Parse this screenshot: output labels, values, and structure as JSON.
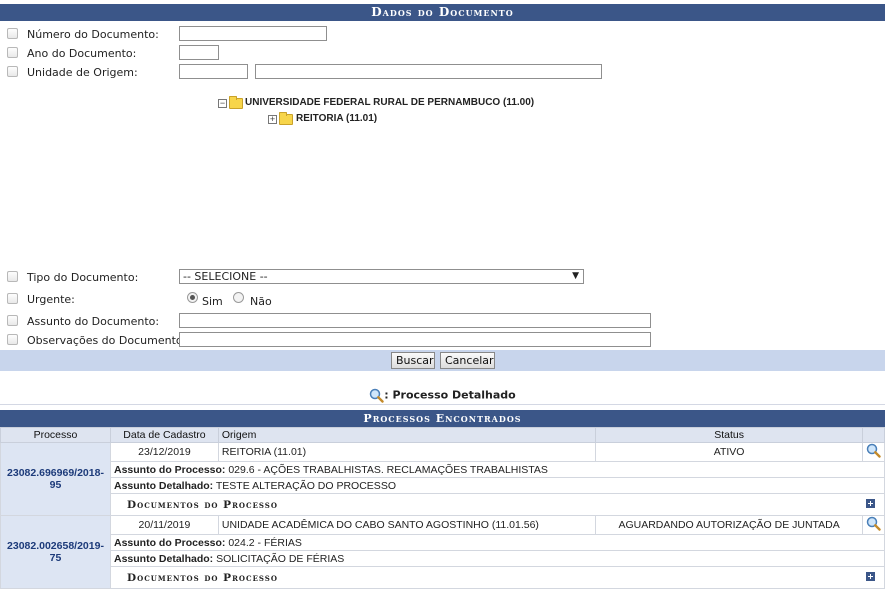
{
  "form": {
    "title": "Dados do Documento",
    "numero_label": "Número do Documento:",
    "ano_label": "Ano do Documento:",
    "unidade_label": "Unidade de Origem:",
    "tipo_label": "Tipo do Documento:",
    "tipo_selected": "-- SELECIONE --",
    "urgente_label": "Urgente:",
    "sim_label": "Sim",
    "nao_label": "Não",
    "assunto_label": "Assunto do Documento:",
    "obs_label": "Observações do Documento:"
  },
  "tree": {
    "root": "UNIVERSIDADE FEDERAL RURAL DE PERNAMBUCO (11.00)",
    "child": "REITORIA (11.01)"
  },
  "buttons": {
    "buscar": "Buscar",
    "cancelar": "Cancelar"
  },
  "legend": {
    "text": ": Processo Detalhado"
  },
  "results": {
    "title": "Processos Encontrados",
    "columns": [
      "Processo",
      "Data de Cadastro",
      "Origem",
      "Status"
    ],
    "assunto_key": "Assunto do Processo:",
    "detalhado_key": "Assunto Detalhado:",
    "docs_label": "Documentos do Processo",
    "rows": [
      {
        "processo": "23082.696969/2018-95",
        "data": "23/12/2019",
        "origem": "REITORIA (11.01)",
        "status": "ATIVO",
        "assunto": "029.6 - AÇÕES TRABALHISTAS. RECLAMAÇÕES TRABALHISTAS",
        "detalhado": "TESTE ALTERAÇÃO DO PROCESSO"
      },
      {
        "processo": "23082.002658/2019-75",
        "data": "20/11/2019",
        "origem": "UNIDADE ACADÊMICA DO CABO SANTO AGOSTINHO (11.01.56)",
        "status": "AGUARDANDO AUTORIZAÇÃO DE JUNTADA",
        "assunto": "024.2 - FÉRIAS",
        "detalhado": "SOLICITAÇÃO DE FÉRIAS"
      }
    ]
  },
  "icons": {
    "magnifier": "magnifier-icon",
    "folder": "folder-icon",
    "expand": "expand-plus-icon",
    "collapse": "collapse-minus-icon"
  },
  "colors": {
    "header_bg": "#3b5688",
    "button_bar": "#c8d5ec",
    "process_cell": "#dde5f3"
  }
}
